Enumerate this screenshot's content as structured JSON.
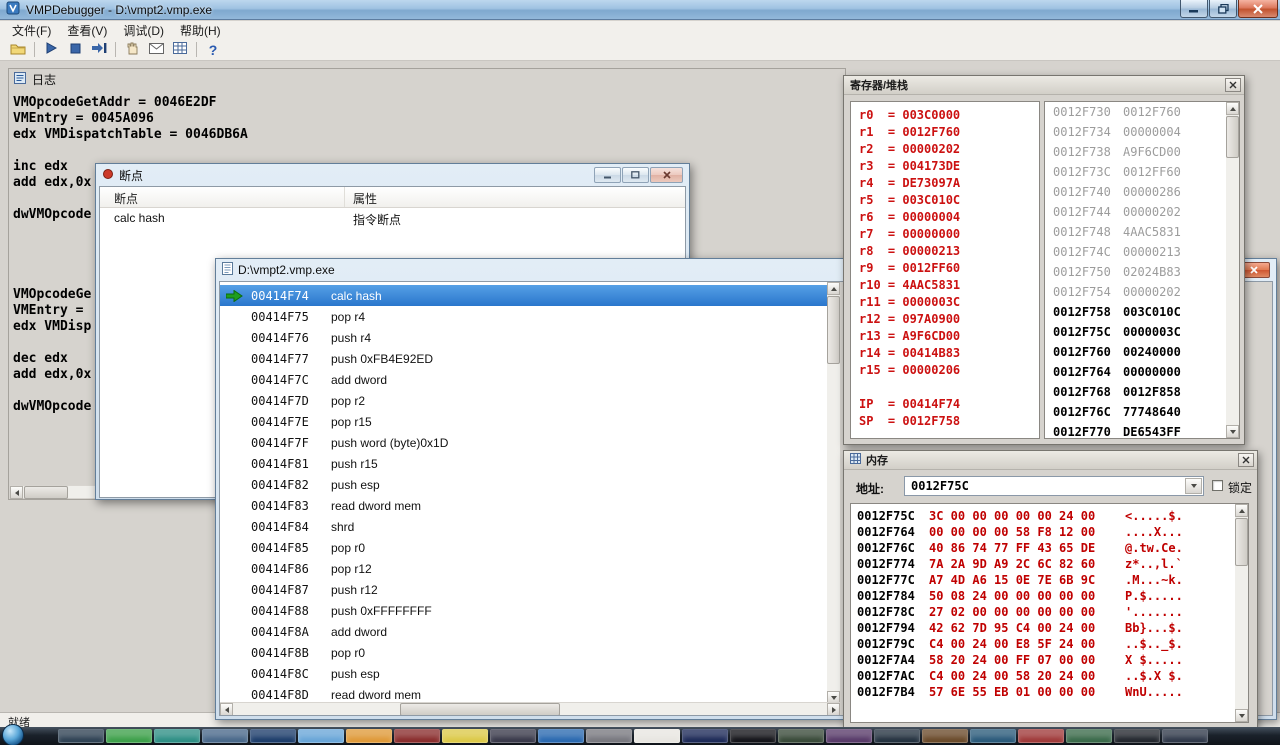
{
  "window": {
    "title": "VMPDebugger - D:\\vmpt2.vmp.exe",
    "menus": [
      "文件(F)",
      "查看(V)",
      "调试(D)",
      "帮助(H)"
    ],
    "status": "就绪"
  },
  "toolbar": {
    "icons": [
      "open-folder",
      "run",
      "stop",
      "step-into",
      "hand",
      "watch-window",
      "grid-view",
      "help"
    ],
    "help_glyph": "?"
  },
  "log": {
    "title": "日志",
    "text": "VMOpcodeGetAddr = 0046E2DF\nVMEntry = 0045A096\nedx VMDispatchTable = 0046DB6A\n\ninc edx\nadd edx,0x\n\ndwVMOpcode\n\n\n\n\nVMOpcodeGe\nVMEntry = \nedx VMDisp\n\ndec edx\nadd edx,0x\n\ndwVMOpcode"
  },
  "breakpoints": {
    "title": "断点",
    "columns": [
      "断点",
      "属性"
    ],
    "rows": [
      {
        "name": "calc hash",
        "attr": "指令断点"
      }
    ]
  },
  "disasm": {
    "title": "D:\\vmpt2.vmp.exe",
    "rows": [
      {
        "addr": "00414F74",
        "ins": "calc hash"
      },
      {
        "addr": "00414F75",
        "ins": "pop r4"
      },
      {
        "addr": "00414F76",
        "ins": "push r4"
      },
      {
        "addr": "00414F77",
        "ins": "push 0xFB4E92ED"
      },
      {
        "addr": "00414F7C",
        "ins": "add dword"
      },
      {
        "addr": "00414F7D",
        "ins": "pop r2"
      },
      {
        "addr": "00414F7E",
        "ins": "pop r15"
      },
      {
        "addr": "00414F7F",
        "ins": "push word (byte)0x1D"
      },
      {
        "addr": "00414F81",
        "ins": "push r15"
      },
      {
        "addr": "00414F82",
        "ins": "push esp"
      },
      {
        "addr": "00414F83",
        "ins": "read dword mem"
      },
      {
        "addr": "00414F84",
        "ins": "shrd"
      },
      {
        "addr": "00414F85",
        "ins": "pop r0"
      },
      {
        "addr": "00414F86",
        "ins": "pop r12"
      },
      {
        "addr": "00414F87",
        "ins": "push r12"
      },
      {
        "addr": "00414F88",
        "ins": "push 0xFFFFFFFF"
      },
      {
        "addr": "00414F8A",
        "ins": "add dword"
      },
      {
        "addr": "00414F8B",
        "ins": "pop r0"
      },
      {
        "addr": "00414F8C",
        "ins": "push esp"
      },
      {
        "addr": "00414F8D",
        "ins": "read dword mem"
      }
    ]
  },
  "registers": {
    "title": "寄存器/堆栈",
    "lines": [
      "r0  = 003C0000",
      "r1  = 0012F760",
      "r2  = 00000202",
      "r3  = 004173DE",
      "r4  = DE73097A",
      "r5  = 003C010C",
      "r6  = 00000004",
      "r7  = 00000000",
      "r8  = 00000213",
      "r9  = 0012FF60",
      "r10 = 4AAC5831",
      "r11 = 0000003C",
      "r12 = 097A0900",
      "r13 = A9F6CD00",
      "r14 = 00414B83",
      "r15 = 00000206",
      "",
      "IP  = 00414F74",
      "SP  = 0012F758"
    ],
    "stack": [
      {
        "addr": "0012F730",
        "val": "0012F760"
      },
      {
        "addr": "0012F734",
        "val": "00000004"
      },
      {
        "addr": "0012F738",
        "val": "A9F6CD00"
      },
      {
        "addr": "0012F73C",
        "val": "0012FF60"
      },
      {
        "addr": "0012F740",
        "val": "00000286"
      },
      {
        "addr": "0012F744",
        "val": "00000202"
      },
      {
        "addr": "0012F748",
        "val": "4AAC5831"
      },
      {
        "addr": "0012F74C",
        "val": "00000213"
      },
      {
        "addr": "0012F750",
        "val": "02024B83"
      },
      {
        "addr": "0012F754",
        "val": "00000202"
      },
      {
        "addr": "0012F758",
        "val": "003C010C"
      },
      {
        "addr": "0012F75C",
        "val": "0000003C"
      },
      {
        "addr": "0012F760",
        "val": "00240000"
      },
      {
        "addr": "0012F764",
        "val": "00000000"
      },
      {
        "addr": "0012F768",
        "val": "0012F858"
      },
      {
        "addr": "0012F76C",
        "val": "77748640"
      },
      {
        "addr": "0012F770",
        "val": "DE6543FF"
      }
    ]
  },
  "memory": {
    "title": "内存",
    "address_label": "地址:",
    "address_value": "0012F75C",
    "lock_label": "锁定",
    "lock_checked": false,
    "rows": [
      {
        "addr": "0012F75C",
        "hex": "3C 00 00 00 00 00 24 00",
        "ascii": "<.....$."
      },
      {
        "addr": "0012F764",
        "hex": "00 00 00 00 58 F8 12 00",
        "ascii": "....X..."
      },
      {
        "addr": "0012F76C",
        "hex": "40 86 74 77 FF 43 65 DE",
        "ascii": "@.tw.Ce."
      },
      {
        "addr": "0012F774",
        "hex": "7A 2A 9D A9 2C 6C 82 60",
        "ascii": "z*..,l.`"
      },
      {
        "addr": "0012F77C",
        "hex": "A7 4D A6 15 0E 7E 6B 9C",
        "ascii": ".M...~k."
      },
      {
        "addr": "0012F784",
        "hex": "50 08 24 00 00 00 00 00",
        "ascii": "P.$....."
      },
      {
        "addr": "0012F78C",
        "hex": "27 02 00 00 00 00 00 00",
        "ascii": "'......."
      },
      {
        "addr": "0012F794",
        "hex": "42 62 7D 95 C4 00 24 00",
        "ascii": "Bb}...$."
      },
      {
        "addr": "0012F79C",
        "hex": "C4 00 24 00 E8 5F 24 00",
        "ascii": "..$.._$."
      },
      {
        "addr": "0012F7A4",
        "hex": "58 20 24 00 FF 07 00 00",
        "ascii": "X $....."
      },
      {
        "addr": "0012F7AC",
        "hex": "C4 00 24 00 58 20 24 00",
        "ascii": "..$.X $."
      },
      {
        "addr": "0012F7B4",
        "hex": "57 6E 55 EB 01 00 00 00",
        "ascii": "WnU....."
      }
    ]
  },
  "taskbar": {
    "tiles": [
      "#2f4254",
      "#3da04a",
      "#2e8f85",
      "#49688a",
      "#1d3d6b",
      "#69a6d8",
      "#df9a39",
      "#8a2d2d",
      "#dcc949",
      "#39394a",
      "#2a69b0",
      "#78787f",
      "#e8e6e1",
      "#1d2a58",
      "#141419",
      "#394a39",
      "#583a69",
      "#243240",
      "#6a4a2a",
      "#2a5a7a",
      "#a03a3a",
      "#3a6a4a",
      "#23272e",
      "#30394a"
    ]
  },
  "colors": {
    "selection_blue": "#2e7dd1",
    "register_red": "#cc1111",
    "memory_red": "#c00000",
    "stack_dim_gray": "#9c9c9c",
    "current_arrow_green": "#1e9e1e",
    "titlebar_blue": "#9fc2e2",
    "close_button_red": "#c2532f"
  }
}
